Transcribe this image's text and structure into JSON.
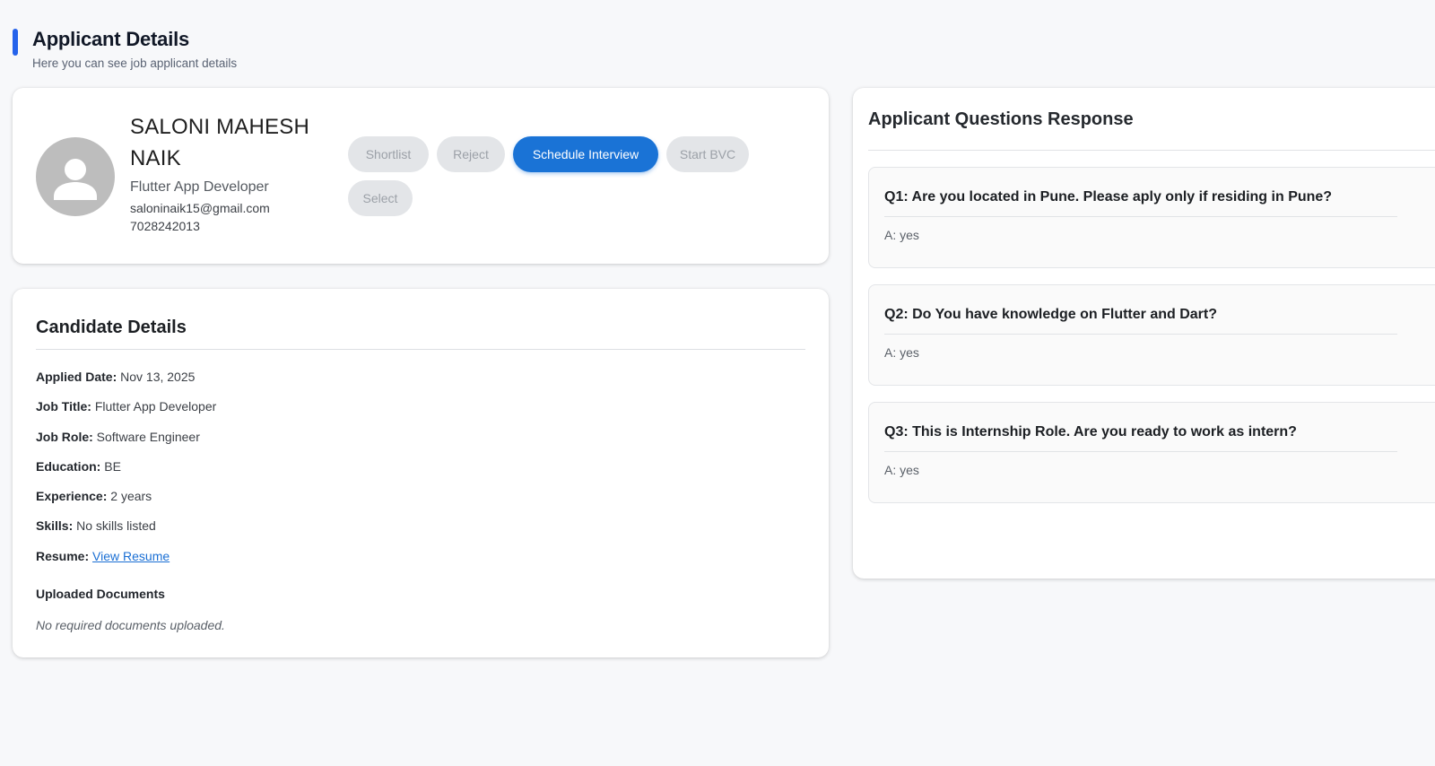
{
  "header": {
    "title": "Applicant Details",
    "subtitle": "Here you can see job applicant details",
    "accent_color": "#2563eb"
  },
  "profile": {
    "avatar_icon": "person-icon",
    "name": "SALONI MAHESH NAIK",
    "role": "Flutter App Developer",
    "email": "saloninaik15@gmail.com",
    "phone": "7028242013"
  },
  "actions": {
    "shortlist": "Shortlist",
    "reject": "Reject",
    "schedule_interview": "Schedule Interview",
    "start_bvc": "Start BVC",
    "select": "Select",
    "primary_color": "#1a73d6"
  },
  "candidate": {
    "heading": "Candidate Details",
    "fields": [
      {
        "label": "Applied Date:",
        "value": "Nov 13, 2025"
      },
      {
        "label": "Job Title:",
        "value": "Flutter App Developer"
      },
      {
        "label": "Job Role:",
        "value": "Software Engineer"
      },
      {
        "label": "Education:",
        "value": "BE"
      },
      {
        "label": "Experience:",
        "value": "2 years"
      },
      {
        "label": "Skills:",
        "value": "No skills listed"
      }
    ],
    "resume_label": "Resume:",
    "resume_link": "View Resume",
    "documents_heading": "Uploaded Documents",
    "documents_empty": "No required documents uploaded."
  },
  "questions": {
    "heading": "Applicant Questions Response",
    "items": [
      {
        "question": "Q1: Are you located in Pune. Please aply only if residing in Pune?",
        "answer": "A: yes"
      },
      {
        "question": "Q2: Do You have knowledge on Flutter and Dart?",
        "answer": "A: yes"
      },
      {
        "question": "Q3: This is Internship Role. Are you ready to work as intern?",
        "answer": "A: yes"
      }
    ]
  }
}
